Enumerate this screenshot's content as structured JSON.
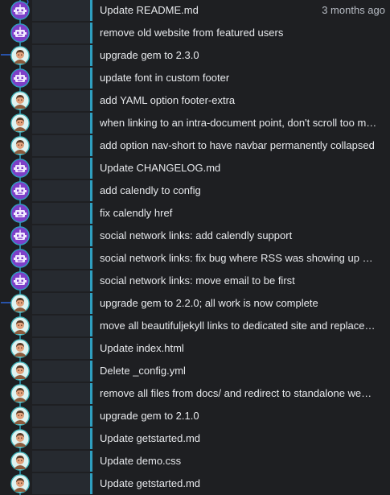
{
  "history": {
    "first_date": "3 months ago",
    "commits": [
      {
        "author": "bot",
        "message": "Update README.md"
      },
      {
        "author": "bot",
        "message": "remove old website from featured users"
      },
      {
        "author": "dean",
        "message": "upgrade gem to 2.3.0"
      },
      {
        "author": "bot",
        "message": "update font in custom footer"
      },
      {
        "author": "dean",
        "message": "add YAML option footer-extra"
      },
      {
        "author": "dean",
        "message": "when linking to an intra-document point, don't scroll too mu..."
      },
      {
        "author": "dean",
        "message": "add option nav-short to have navbar permanently collapsed"
      },
      {
        "author": "bot",
        "message": "Update CHANGELOG.md"
      },
      {
        "author": "bot",
        "message": "add calendly to config"
      },
      {
        "author": "bot",
        "message": "fix calendly href"
      },
      {
        "author": "bot",
        "message": "social network links: add calendly support"
      },
      {
        "author": "bot",
        "message": "social network links: fix bug where RSS was showing up even..."
      },
      {
        "author": "bot",
        "message": "social network links: move email to be first"
      },
      {
        "author": "dean",
        "message": "upgrade gem to 2.2.0; all work is now complete"
      },
      {
        "author": "dean",
        "message": "move all beautifuljekyll links to dedicated site and replace ht..."
      },
      {
        "author": "dean",
        "message": "Update index.html"
      },
      {
        "author": "dean",
        "message": "Delete _config.yml"
      },
      {
        "author": "dean",
        "message": "remove all files from docs/ and redirect to standalone website"
      },
      {
        "author": "dean",
        "message": "upgrade gem to 2.1.0"
      },
      {
        "author": "dean",
        "message": "Update getstarted.md"
      },
      {
        "author": "dean",
        "message": "Update demo.css"
      },
      {
        "author": "dean",
        "message": "Update getstarted.md"
      }
    ]
  },
  "colors": {
    "background": "#1e1f22",
    "row_band": "#262a30",
    "accent_bar": "#2f9fc0",
    "graph_line_main": "#2f9fc0",
    "graph_line_branch": "#2c63d6",
    "bot_avatar_bg": "#7d3fc8",
    "bot_avatar_ring": "#2f9fc0",
    "person_avatar_bg": "#c97f57",
    "person_avatar_ring": "#3fb0b6"
  },
  "icons": {
    "bot": "robot-avatar-icon",
    "dean": "person-avatar-icon"
  }
}
